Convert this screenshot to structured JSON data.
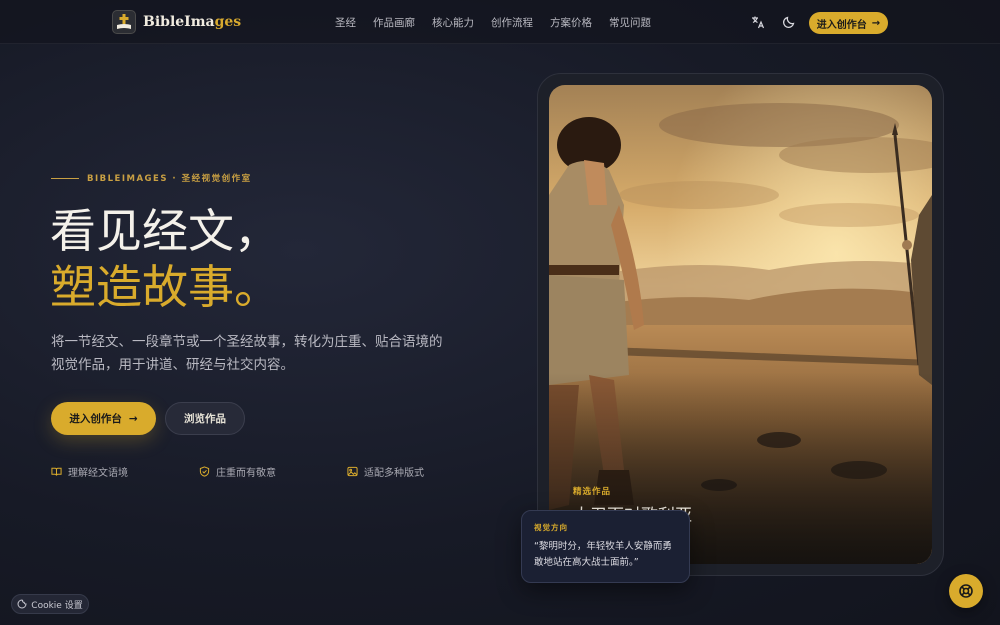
{
  "brand": {
    "name_main": "BibleIma",
    "name_accent": "ges"
  },
  "nav": {
    "items": [
      "圣经",
      "作品画廊",
      "核心能力",
      "创作流程",
      "方案价格",
      "常见问题"
    ],
    "cta_label": "进入创作台"
  },
  "hero": {
    "eyebrow": "BIBLEIMAGES · 圣经视觉创作室",
    "title_line1": "看见经文，",
    "title_line2": "塑造故事。",
    "subtitle": "将一节经文、一段章节或一个圣经故事，转化为庄重、贴合语境的视觉作品，用于讲道、研经与社交内容。",
    "primary_button": "进入创作台",
    "secondary_button": "浏览作品",
    "features": [
      {
        "icon": "book-icon",
        "label": "理解经文语境"
      },
      {
        "icon": "shield-icon",
        "label": "庄重而有敬意"
      },
      {
        "icon": "image-icon",
        "label": "适配多种版式"
      }
    ]
  },
  "showcase": {
    "tag": "精选作品",
    "title": "大卫面对歌利亚",
    "caption_label": "视觉方向",
    "caption_text": "“黎明时分，年轻牧羊人安静而勇敢地站在高大战士面前。”"
  },
  "cookie_label": "Cookie 设置",
  "colors": {
    "accent": "#d9ab2c",
    "background": "#171a26"
  }
}
